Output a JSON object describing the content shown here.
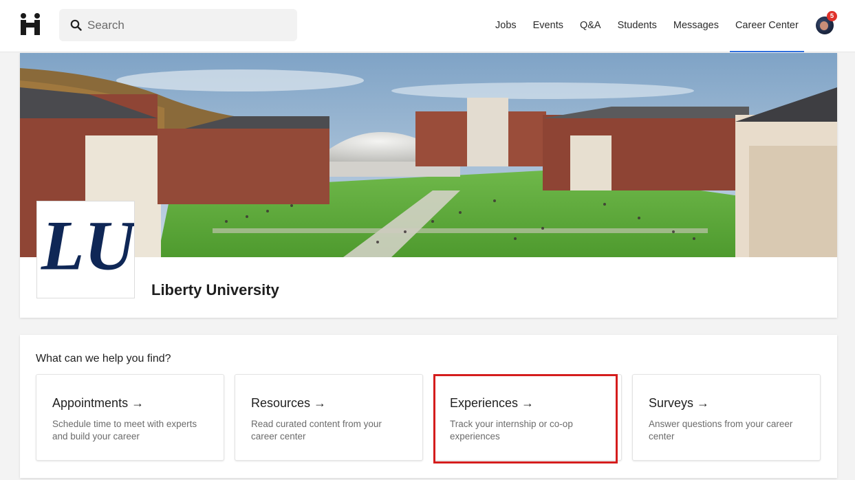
{
  "search": {
    "placeholder": "Search"
  },
  "nav": {
    "items": [
      {
        "label": "Jobs"
      },
      {
        "label": "Events"
      },
      {
        "label": "Q&A"
      },
      {
        "label": "Students"
      },
      {
        "label": "Messages"
      },
      {
        "label": "Career Center",
        "active": true
      }
    ],
    "notification_count": "5"
  },
  "school": {
    "name": "Liberty University",
    "logo_text": "LU",
    "logo_color": "#0f2756"
  },
  "help": {
    "title": "What can we help you find?",
    "tiles": [
      {
        "title": "Appointments →",
        "description": "Schedule time to meet with experts and build your career"
      },
      {
        "title": "Resources →",
        "description": "Read curated content from your career center"
      },
      {
        "title": "Experiences →",
        "description": "Track your internship or co-op experiences",
        "highlighted": true
      },
      {
        "title": "Surveys →",
        "description": "Answer questions from your career center"
      }
    ]
  },
  "colors": {
    "accent": "#2f6fde",
    "highlight": "#d51d1d",
    "badge": "#e0322b"
  }
}
